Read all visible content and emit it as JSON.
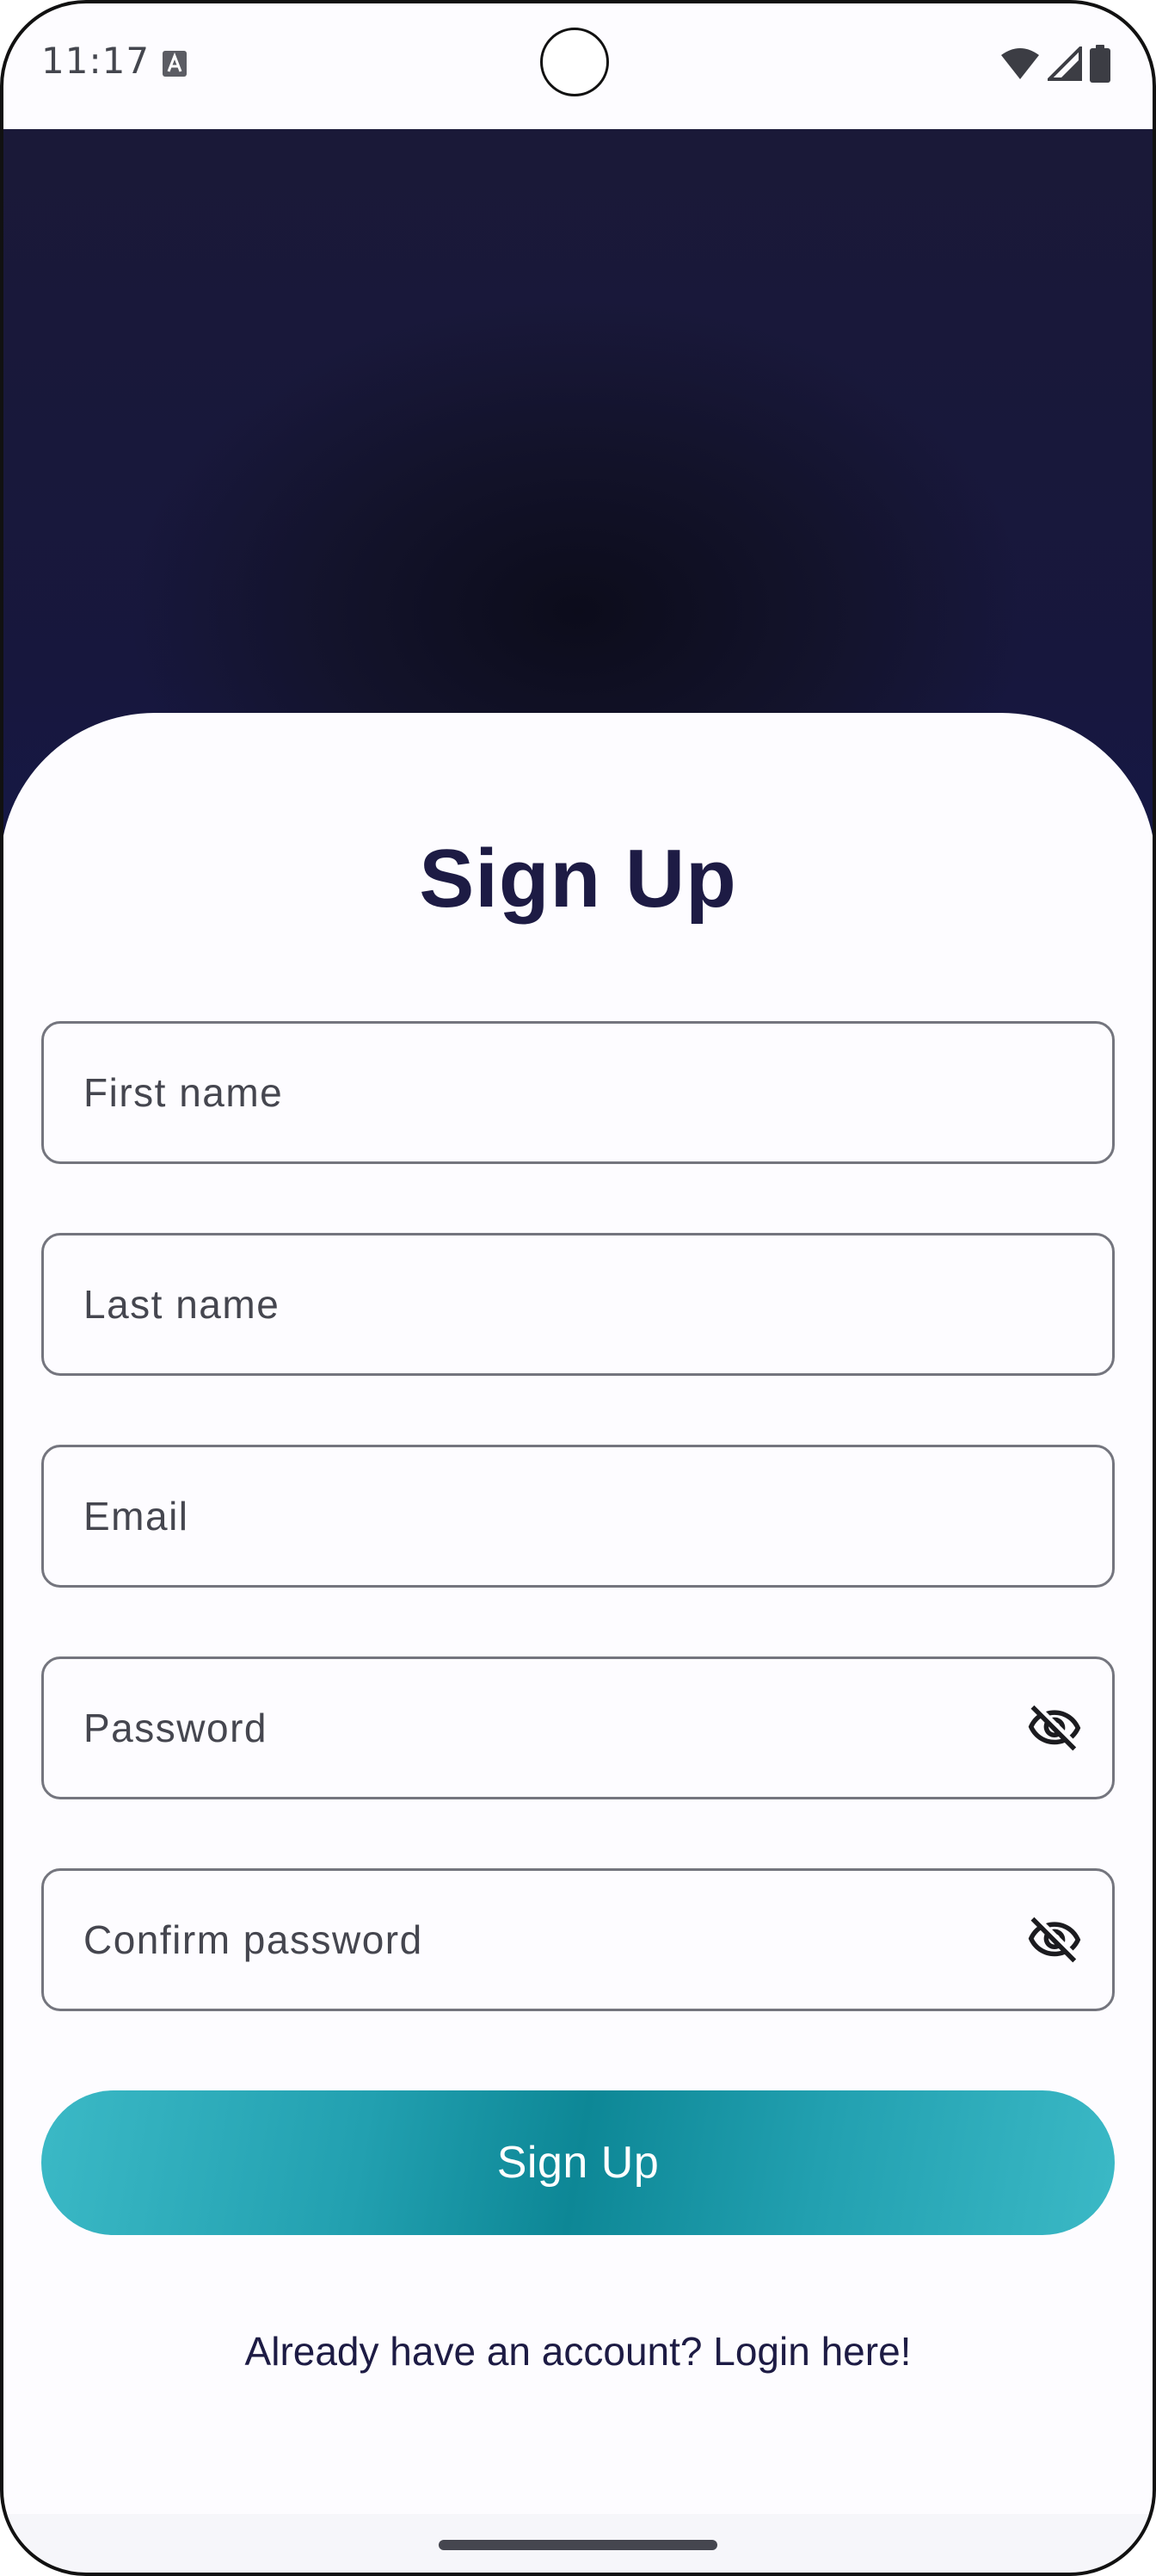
{
  "status_bar": {
    "time": "11:17",
    "icons": [
      "text-accessibility-icon",
      "wifi-icon",
      "cellular-signal-icon",
      "battery-icon"
    ]
  },
  "form": {
    "title": "Sign Up",
    "first_name_placeholder": "First name",
    "last_name_placeholder": "Last name",
    "email_placeholder": "Email",
    "password_placeholder": "Password",
    "confirm_password_placeholder": "Confirm password",
    "password_toggle_icon": "visibility-off-icon",
    "submit_label": "Sign Up",
    "login_link": "Already have an account? Login here!"
  },
  "colors": {
    "hero_dark": "#13132b",
    "title": "#1d1b44",
    "button_accent": "#22a0b0",
    "field_border": "#74757e"
  }
}
